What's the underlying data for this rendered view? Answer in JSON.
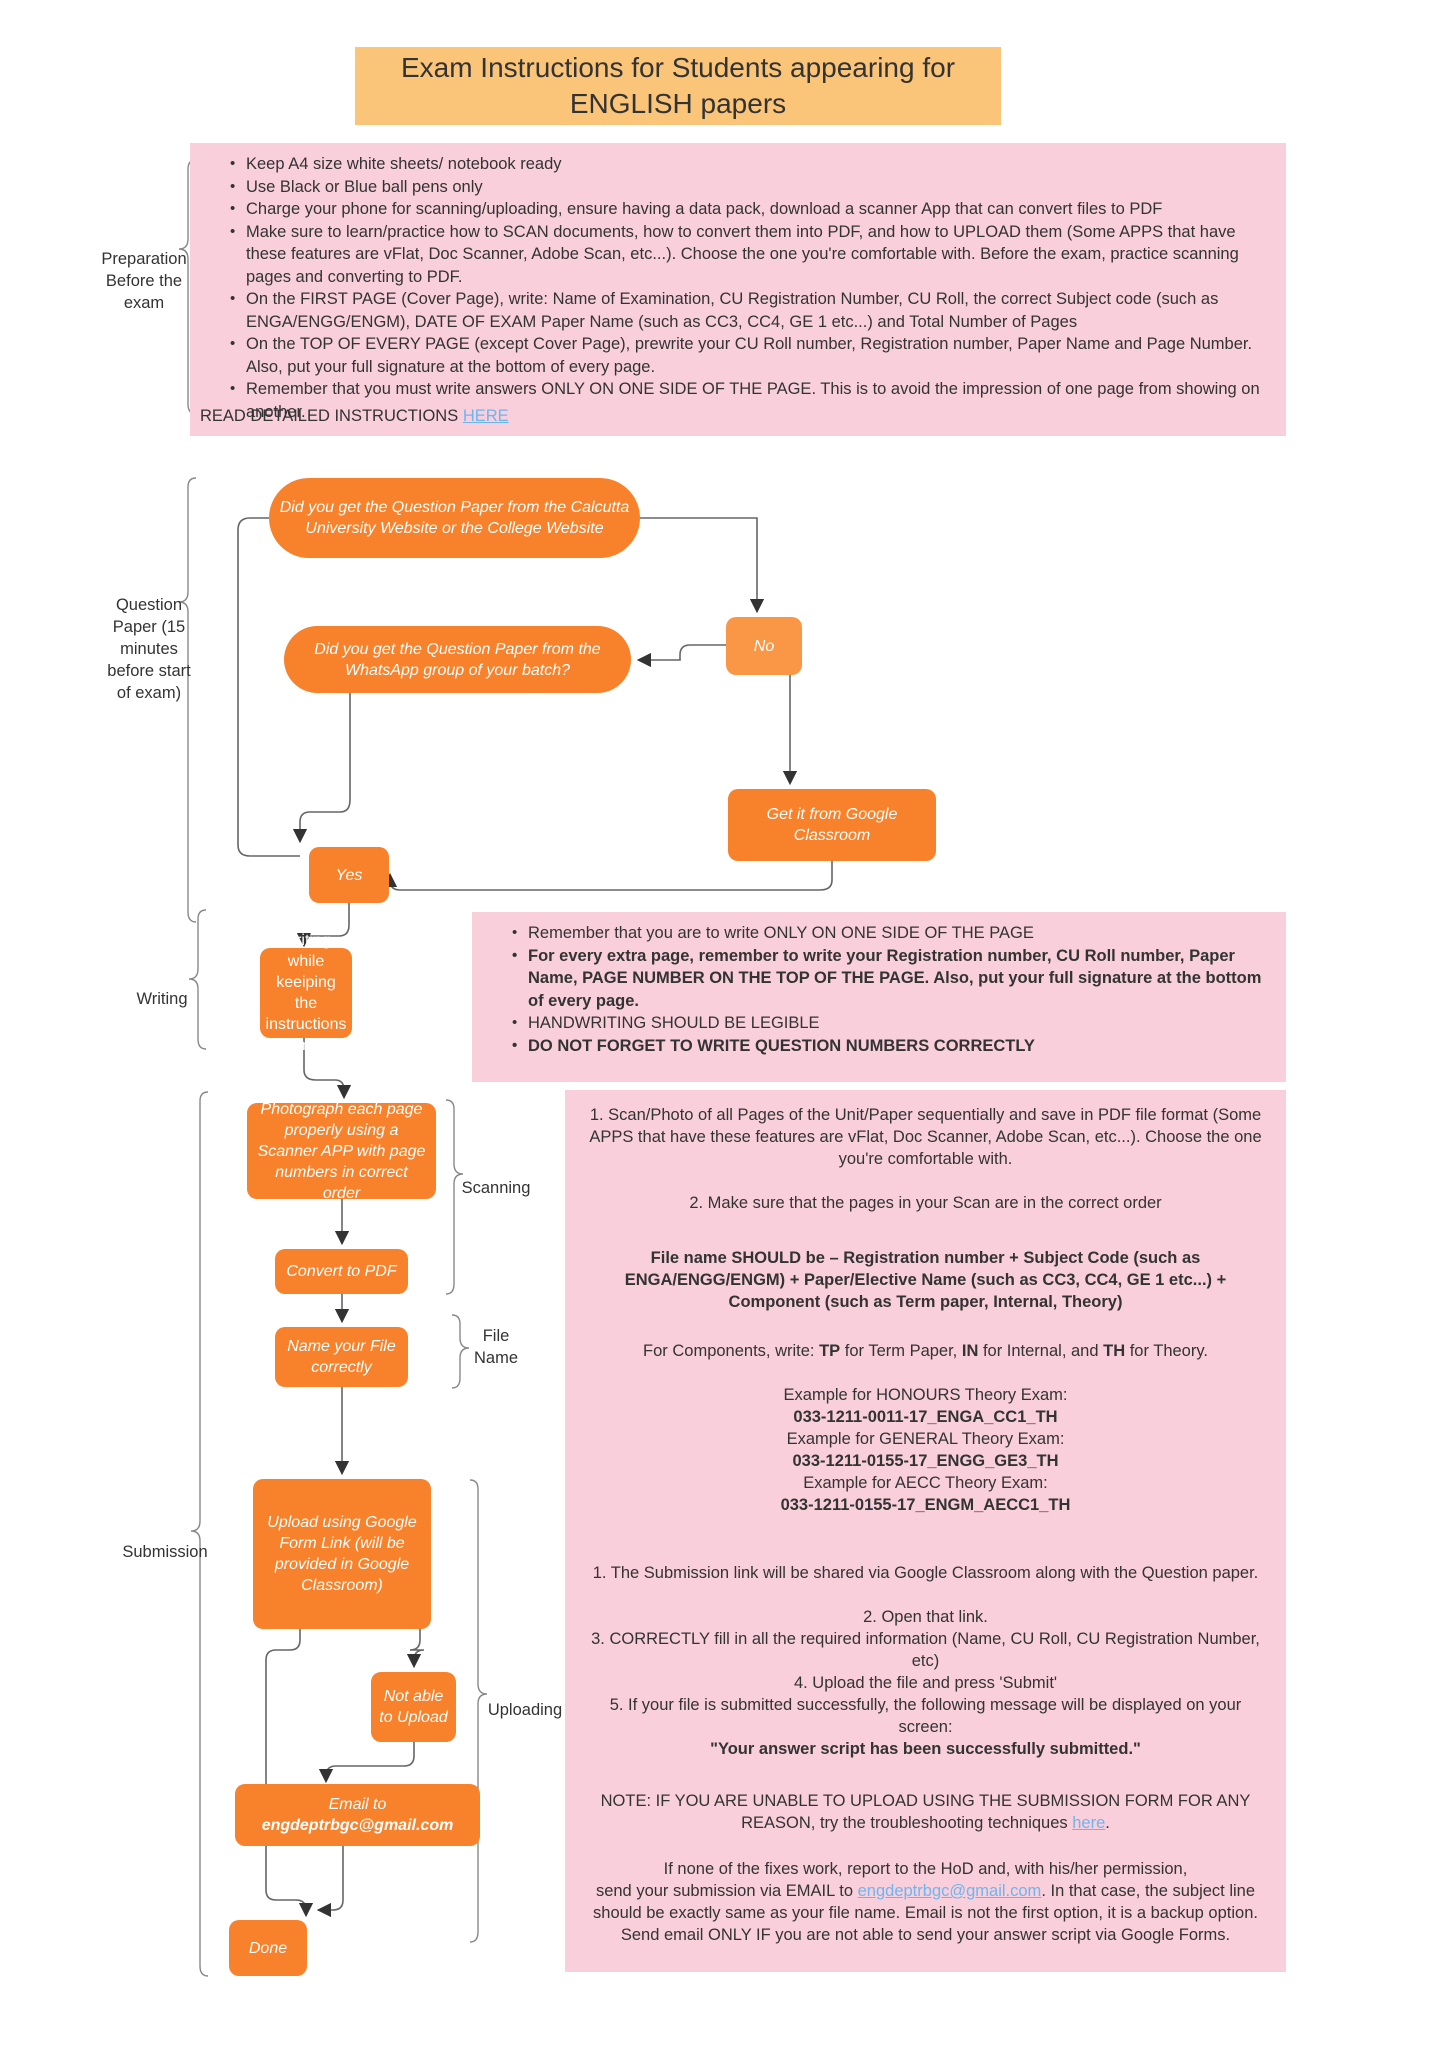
{
  "title": "Exam Instructions for Students appearing for ENGLISH papers",
  "preparation": {
    "stage_label": "Preparation Before the exam",
    "bullets": [
      "Keep A4 size white sheets/ notebook ready",
      "Use Black or Blue ball pens only",
      "Charge your phone for scanning/uploading, ensure having a data pack, download a scanner App that can convert files to PDF",
      "Make sure to learn/practice how to SCAN documents, how to convert them into PDF, and how to UPLOAD them (Some APPS that have these features are vFlat, Doc Scanner, Adobe Scan, etc...). Choose the one you're comfortable with. Before the exam, practice scanning pages and converting to PDF.",
      "On the FIRST PAGE (Cover Page), write: Name of Examination, CU Registration Number, CU Roll, the correct Subject code (such as ENGA/ENGG/ENGM), DATE OF EXAM  Paper Name (such as CC3, CC4, GE 1 etc...) and Total Number of Pages",
      "On the TOP OF EVERY PAGE (except Cover Page), prewrite your CU Roll number, Registration number, Paper Name and Page Number. Also, put your full signature at the bottom of every page.",
      "Remember that you must write answers ONLY ON ONE SIDE OF THE PAGE. This is to avoid the impression of one page from showing on another."
    ],
    "read_more_text": "READ DETAILED INSTRUCTIONS ",
    "read_more_link": "HERE"
  },
  "question_paper": {
    "stage_label": "Question Paper (15 minutes before start of exam)",
    "q1": "Did you get the Question Paper from the Calcutta University Website or the College Website",
    "q2": "Did you get the Question Paper from the WhatsApp group of your batch?",
    "no": "No",
    "google_classroom": "Get it from Google Classroom",
    "yes": "Yes"
  },
  "writing": {
    "stage_label": "Writing",
    "node": "Writing while keeiping the instructions in mind",
    "bullets": [
      {
        "text": "Remember that you are to write ONLY ON ONE SIDE OF THE PAGE",
        "bold": false
      },
      {
        "text": "For every extra page, remember to write your Registration number, CU Roll number, Paper Name, PAGE NUMBER ON THE TOP OF THE PAGE. Also, put your full signature at the bottom of every page.",
        "bold": true
      },
      {
        "text": "HANDWRITING SHOULD BE LEGIBLE",
        "bold": false
      },
      {
        "text": "DO NOT FORGET TO WRITE QUESTION NUMBERS CORRECTLY",
        "bold": true
      }
    ]
  },
  "scanning": {
    "stage_label": "Scanning",
    "node_photo": "Photograph each page properly using a Scanner APP with page numbers in correct order",
    "node_pdf": "Convert to PDF"
  },
  "file_name": {
    "stage_label": "File Name",
    "node": "Name your File correctly"
  },
  "submission": {
    "stage_label": "Submission",
    "node_upload": "Upload using Google Form Link (will be provided in Google Classroom)"
  },
  "uploading": {
    "stage_label": "Uploading",
    "node_not_able": "Not able to Upload",
    "node_email_line1": "Email to",
    "node_email_line2": "engdeptrbgc@gmail.com",
    "node_done": "Done"
  },
  "procedure_panel": {
    "scan_step1": "1. Scan/Photo of all Pages of the Unit/Paper sequentially and save in PDF file format (Some APPS that have these features are vFlat, Doc Scanner, Adobe Scan, etc...). Choose the one you're comfortable with.",
    "scan_step2": "2. Make sure that the pages in your Scan are in the correct order",
    "file_name_rule": "File name SHOULD be – Registration number + Subject Code (such as ENGA/ENGG/ENGM) + Paper/Elective Name (such as CC3, CC4, GE 1 etc...) + Component (such as Term paper, Internal, Theory)",
    "components_line_1": "For Components, write: ",
    "components_tp": "TP",
    "components_line_2": " for Term Paper, ",
    "components_in": "IN",
    "components_line_3": " for Internal, and ",
    "components_th": "TH",
    "components_line_4": " for Theory.",
    "example_honours_label": "Example for HONOURS Theory Exam:",
    "example_honours_value": "033-1211-0011-17_ENGA_CC1_TH",
    "example_general_label": "Example for GENERAL Theory Exam:",
    "example_general_value": "033-1211-0155-17_ENGG_GE3_TH",
    "example_aecc_label": "Example for AECC Theory Exam:",
    "example_aecc_value": "033-1211-0155-17_ENGM_AECC1_TH",
    "submit_step1": "1. The Submission link will be shared via Google Classroom along with the Question paper.",
    "submit_step2": "2. Open that link.",
    "submit_step3": "3. CORRECTLY fill in all the required information (Name, CU Roll, CU Registration Number, etc)",
    "submit_step4": "4. Upload the file and press 'Submit'",
    "submit_step5": "5. If your file is submitted successfully, the following message will be displayed on your screen:",
    "submit_success_msg": "\"Your answer script has been successfully submitted.\"",
    "note_line1": "NOTE: IF YOU ARE UNABLE TO UPLOAD USING THE SUBMISSION FORM FOR ANY REASON, try the troubleshooting techniques ",
    "note_link": "here",
    "note_line2": ".",
    "fallback_line1": "If none of the fixes work, report to the HoD and, with his/her permission,",
    "fallback_line2a": "send your submission via EMAIL to ",
    "fallback_email": "engdeptrbgc@gmail.com",
    "fallback_line2b": ". In that case, the subject line should be exactly same as your file name. Email is not the first option, it is a backup option. Send email ONLY IF you are not able to send your answer script via Google Forms."
  },
  "colors": {
    "title_bg": "#fac479",
    "panel_bg": "#f9cfdc",
    "node_bg": "#f8822c",
    "link": "#6cb6f0"
  }
}
